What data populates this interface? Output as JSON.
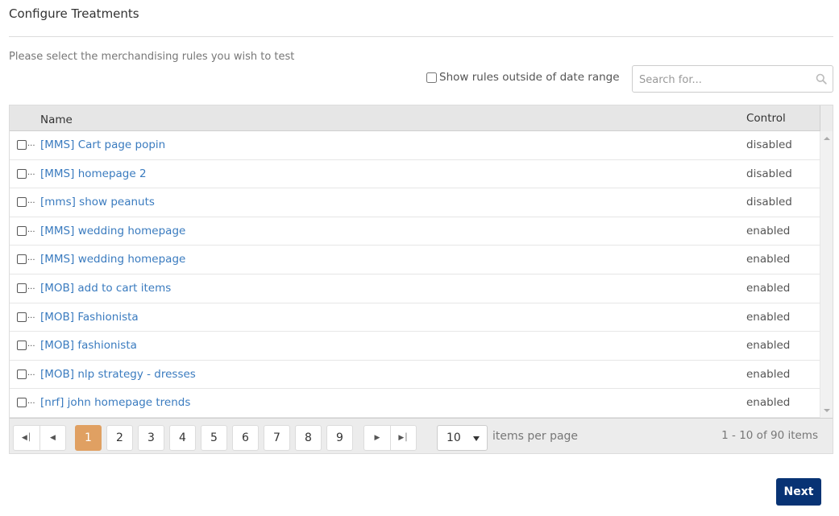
{
  "page": {
    "title": "Configure Treatments",
    "subtitle": "Please select the merchandising rules you wish to test"
  },
  "filters": {
    "show_outside_date_range_label": "Show rules outside of date range",
    "show_outside_date_range_checked": false,
    "search_placeholder": "Search for...",
    "search_value": ""
  },
  "grid": {
    "columns": {
      "name": "Name",
      "control": "Control"
    },
    "rows": [
      {
        "name": "[MMS] Cart page popin",
        "control": "disabled",
        "checked": false
      },
      {
        "name": "[MMS] homepage 2",
        "control": "disabled",
        "checked": false
      },
      {
        "name": "[mms] show peanuts",
        "control": "disabled",
        "checked": false
      },
      {
        "name": "[MMS] wedding homepage",
        "control": "enabled",
        "checked": false
      },
      {
        "name": "[MMS] wedding homepage",
        "control": "enabled",
        "checked": false
      },
      {
        "name": "[MOB] add to cart items",
        "control": "enabled",
        "checked": false
      },
      {
        "name": "[MOB] Fashionista",
        "control": "enabled",
        "checked": false
      },
      {
        "name": "[MOB] fashionista",
        "control": "enabled",
        "checked": false
      },
      {
        "name": "[MOB] nlp strategy - dresses",
        "control": "enabled",
        "checked": false
      },
      {
        "name": "[nrf] john homepage trends",
        "control": "enabled",
        "checked": false
      }
    ],
    "row_ellipsis": "..."
  },
  "pager": {
    "first_icon": "first-page-icon",
    "prev_icon": "prev-page-icon",
    "next_icon": "next-page-icon",
    "last_icon": "last-page-icon",
    "pages": [
      "1",
      "2",
      "3",
      "4",
      "5",
      "6",
      "7",
      "8",
      "9"
    ],
    "current_page": "1",
    "page_size": "10",
    "page_size_label": "items per page",
    "info": "1 - 10 of 90 items"
  },
  "actions": {
    "next_label": "Next"
  },
  "colors": {
    "link": "#3a7bbf",
    "active_page": "#e0a062",
    "primary_button": "#083374"
  }
}
